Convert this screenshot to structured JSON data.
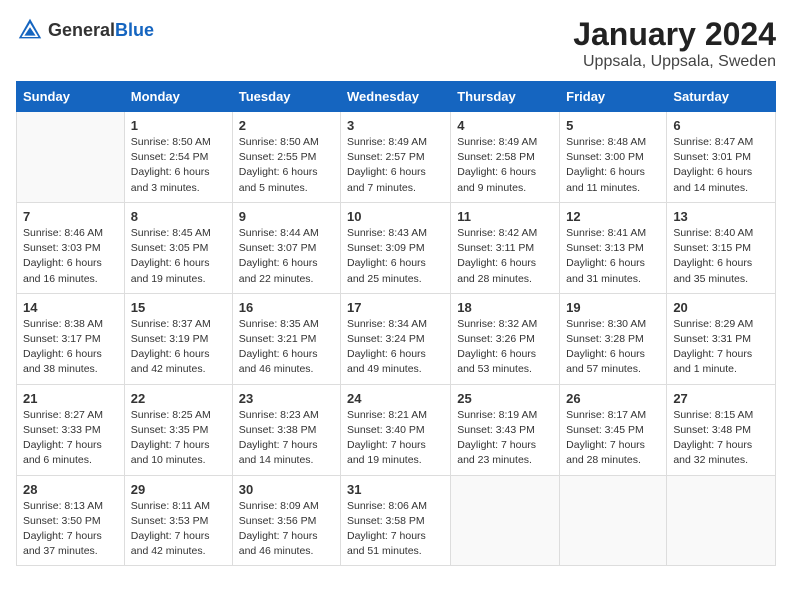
{
  "header": {
    "logo_general": "General",
    "logo_blue": "Blue",
    "month": "January 2024",
    "location": "Uppsala, Uppsala, Sweden"
  },
  "days_of_week": [
    "Sunday",
    "Monday",
    "Tuesday",
    "Wednesday",
    "Thursday",
    "Friday",
    "Saturday"
  ],
  "weeks": [
    [
      {
        "day": "",
        "sunrise": "",
        "sunset": "",
        "daylight": ""
      },
      {
        "day": "1",
        "sunrise": "Sunrise: 8:50 AM",
        "sunset": "Sunset: 2:54 PM",
        "daylight": "Daylight: 6 hours and 3 minutes."
      },
      {
        "day": "2",
        "sunrise": "Sunrise: 8:50 AM",
        "sunset": "Sunset: 2:55 PM",
        "daylight": "Daylight: 6 hours and 5 minutes."
      },
      {
        "day": "3",
        "sunrise": "Sunrise: 8:49 AM",
        "sunset": "Sunset: 2:57 PM",
        "daylight": "Daylight: 6 hours and 7 minutes."
      },
      {
        "day": "4",
        "sunrise": "Sunrise: 8:49 AM",
        "sunset": "Sunset: 2:58 PM",
        "daylight": "Daylight: 6 hours and 9 minutes."
      },
      {
        "day": "5",
        "sunrise": "Sunrise: 8:48 AM",
        "sunset": "Sunset: 3:00 PM",
        "daylight": "Daylight: 6 hours and 11 minutes."
      },
      {
        "day": "6",
        "sunrise": "Sunrise: 8:47 AM",
        "sunset": "Sunset: 3:01 PM",
        "daylight": "Daylight: 6 hours and 14 minutes."
      }
    ],
    [
      {
        "day": "7",
        "sunrise": "Sunrise: 8:46 AM",
        "sunset": "Sunset: 3:03 PM",
        "daylight": "Daylight: 6 hours and 16 minutes."
      },
      {
        "day": "8",
        "sunrise": "Sunrise: 8:45 AM",
        "sunset": "Sunset: 3:05 PM",
        "daylight": "Daylight: 6 hours and 19 minutes."
      },
      {
        "day": "9",
        "sunrise": "Sunrise: 8:44 AM",
        "sunset": "Sunset: 3:07 PM",
        "daylight": "Daylight: 6 hours and 22 minutes."
      },
      {
        "day": "10",
        "sunrise": "Sunrise: 8:43 AM",
        "sunset": "Sunset: 3:09 PM",
        "daylight": "Daylight: 6 hours and 25 minutes."
      },
      {
        "day": "11",
        "sunrise": "Sunrise: 8:42 AM",
        "sunset": "Sunset: 3:11 PM",
        "daylight": "Daylight: 6 hours and 28 minutes."
      },
      {
        "day": "12",
        "sunrise": "Sunrise: 8:41 AM",
        "sunset": "Sunset: 3:13 PM",
        "daylight": "Daylight: 6 hours and 31 minutes."
      },
      {
        "day": "13",
        "sunrise": "Sunrise: 8:40 AM",
        "sunset": "Sunset: 3:15 PM",
        "daylight": "Daylight: 6 hours and 35 minutes."
      }
    ],
    [
      {
        "day": "14",
        "sunrise": "Sunrise: 8:38 AM",
        "sunset": "Sunset: 3:17 PM",
        "daylight": "Daylight: 6 hours and 38 minutes."
      },
      {
        "day": "15",
        "sunrise": "Sunrise: 8:37 AM",
        "sunset": "Sunset: 3:19 PM",
        "daylight": "Daylight: 6 hours and 42 minutes."
      },
      {
        "day": "16",
        "sunrise": "Sunrise: 8:35 AM",
        "sunset": "Sunset: 3:21 PM",
        "daylight": "Daylight: 6 hours and 46 minutes."
      },
      {
        "day": "17",
        "sunrise": "Sunrise: 8:34 AM",
        "sunset": "Sunset: 3:24 PM",
        "daylight": "Daylight: 6 hours and 49 minutes."
      },
      {
        "day": "18",
        "sunrise": "Sunrise: 8:32 AM",
        "sunset": "Sunset: 3:26 PM",
        "daylight": "Daylight: 6 hours and 53 minutes."
      },
      {
        "day": "19",
        "sunrise": "Sunrise: 8:30 AM",
        "sunset": "Sunset: 3:28 PM",
        "daylight": "Daylight: 6 hours and 57 minutes."
      },
      {
        "day": "20",
        "sunrise": "Sunrise: 8:29 AM",
        "sunset": "Sunset: 3:31 PM",
        "daylight": "Daylight: 7 hours and 1 minute."
      }
    ],
    [
      {
        "day": "21",
        "sunrise": "Sunrise: 8:27 AM",
        "sunset": "Sunset: 3:33 PM",
        "daylight": "Daylight: 7 hours and 6 minutes."
      },
      {
        "day": "22",
        "sunrise": "Sunrise: 8:25 AM",
        "sunset": "Sunset: 3:35 PM",
        "daylight": "Daylight: 7 hours and 10 minutes."
      },
      {
        "day": "23",
        "sunrise": "Sunrise: 8:23 AM",
        "sunset": "Sunset: 3:38 PM",
        "daylight": "Daylight: 7 hours and 14 minutes."
      },
      {
        "day": "24",
        "sunrise": "Sunrise: 8:21 AM",
        "sunset": "Sunset: 3:40 PM",
        "daylight": "Daylight: 7 hours and 19 minutes."
      },
      {
        "day": "25",
        "sunrise": "Sunrise: 8:19 AM",
        "sunset": "Sunset: 3:43 PM",
        "daylight": "Daylight: 7 hours and 23 minutes."
      },
      {
        "day": "26",
        "sunrise": "Sunrise: 8:17 AM",
        "sunset": "Sunset: 3:45 PM",
        "daylight": "Daylight: 7 hours and 28 minutes."
      },
      {
        "day": "27",
        "sunrise": "Sunrise: 8:15 AM",
        "sunset": "Sunset: 3:48 PM",
        "daylight": "Daylight: 7 hours and 32 minutes."
      }
    ],
    [
      {
        "day": "28",
        "sunrise": "Sunrise: 8:13 AM",
        "sunset": "Sunset: 3:50 PM",
        "daylight": "Daylight: 7 hours and 37 minutes."
      },
      {
        "day": "29",
        "sunrise": "Sunrise: 8:11 AM",
        "sunset": "Sunset: 3:53 PM",
        "daylight": "Daylight: 7 hours and 42 minutes."
      },
      {
        "day": "30",
        "sunrise": "Sunrise: 8:09 AM",
        "sunset": "Sunset: 3:56 PM",
        "daylight": "Daylight: 7 hours and 46 minutes."
      },
      {
        "day": "31",
        "sunrise": "Sunrise: 8:06 AM",
        "sunset": "Sunset: 3:58 PM",
        "daylight": "Daylight: 7 hours and 51 minutes."
      },
      {
        "day": "",
        "sunrise": "",
        "sunset": "",
        "daylight": ""
      },
      {
        "day": "",
        "sunrise": "",
        "sunset": "",
        "daylight": ""
      },
      {
        "day": "",
        "sunrise": "",
        "sunset": "",
        "daylight": ""
      }
    ]
  ]
}
